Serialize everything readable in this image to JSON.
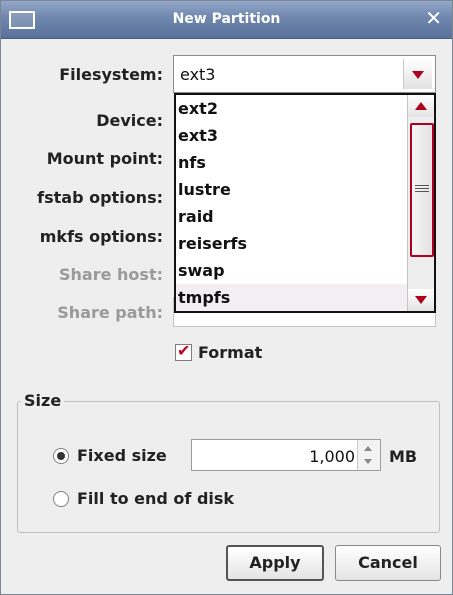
{
  "window": {
    "title": "New Partition"
  },
  "form": {
    "filesystem_label": "Filesystem:",
    "device_label": "Device:",
    "mount_point_label": "Mount point:",
    "fstab_label": "fstab options:",
    "mkfs_label": "mkfs options:",
    "share_host_label": "Share host:",
    "share_path_label": "Share path:",
    "filesystem_value": "ext3",
    "options": [
      "ext2",
      "ext3",
      "nfs",
      "lustre",
      "raid",
      "reiserfs",
      "swap",
      "tmpfs"
    ],
    "highlighted_option": "tmpfs",
    "format_label": "Format",
    "format_checked": true
  },
  "size": {
    "group_title": "Size",
    "fixed_label": "Fixed size",
    "fixed_value": "1,000",
    "unit": "MB",
    "fill_label": "Fill to end of disk",
    "selected": "fixed"
  },
  "buttons": {
    "apply": "Apply",
    "cancel": "Cancel"
  },
  "colors": {
    "accent": "#b0001f",
    "titlebar": "#6f86ad",
    "background": "#eeeeee"
  }
}
